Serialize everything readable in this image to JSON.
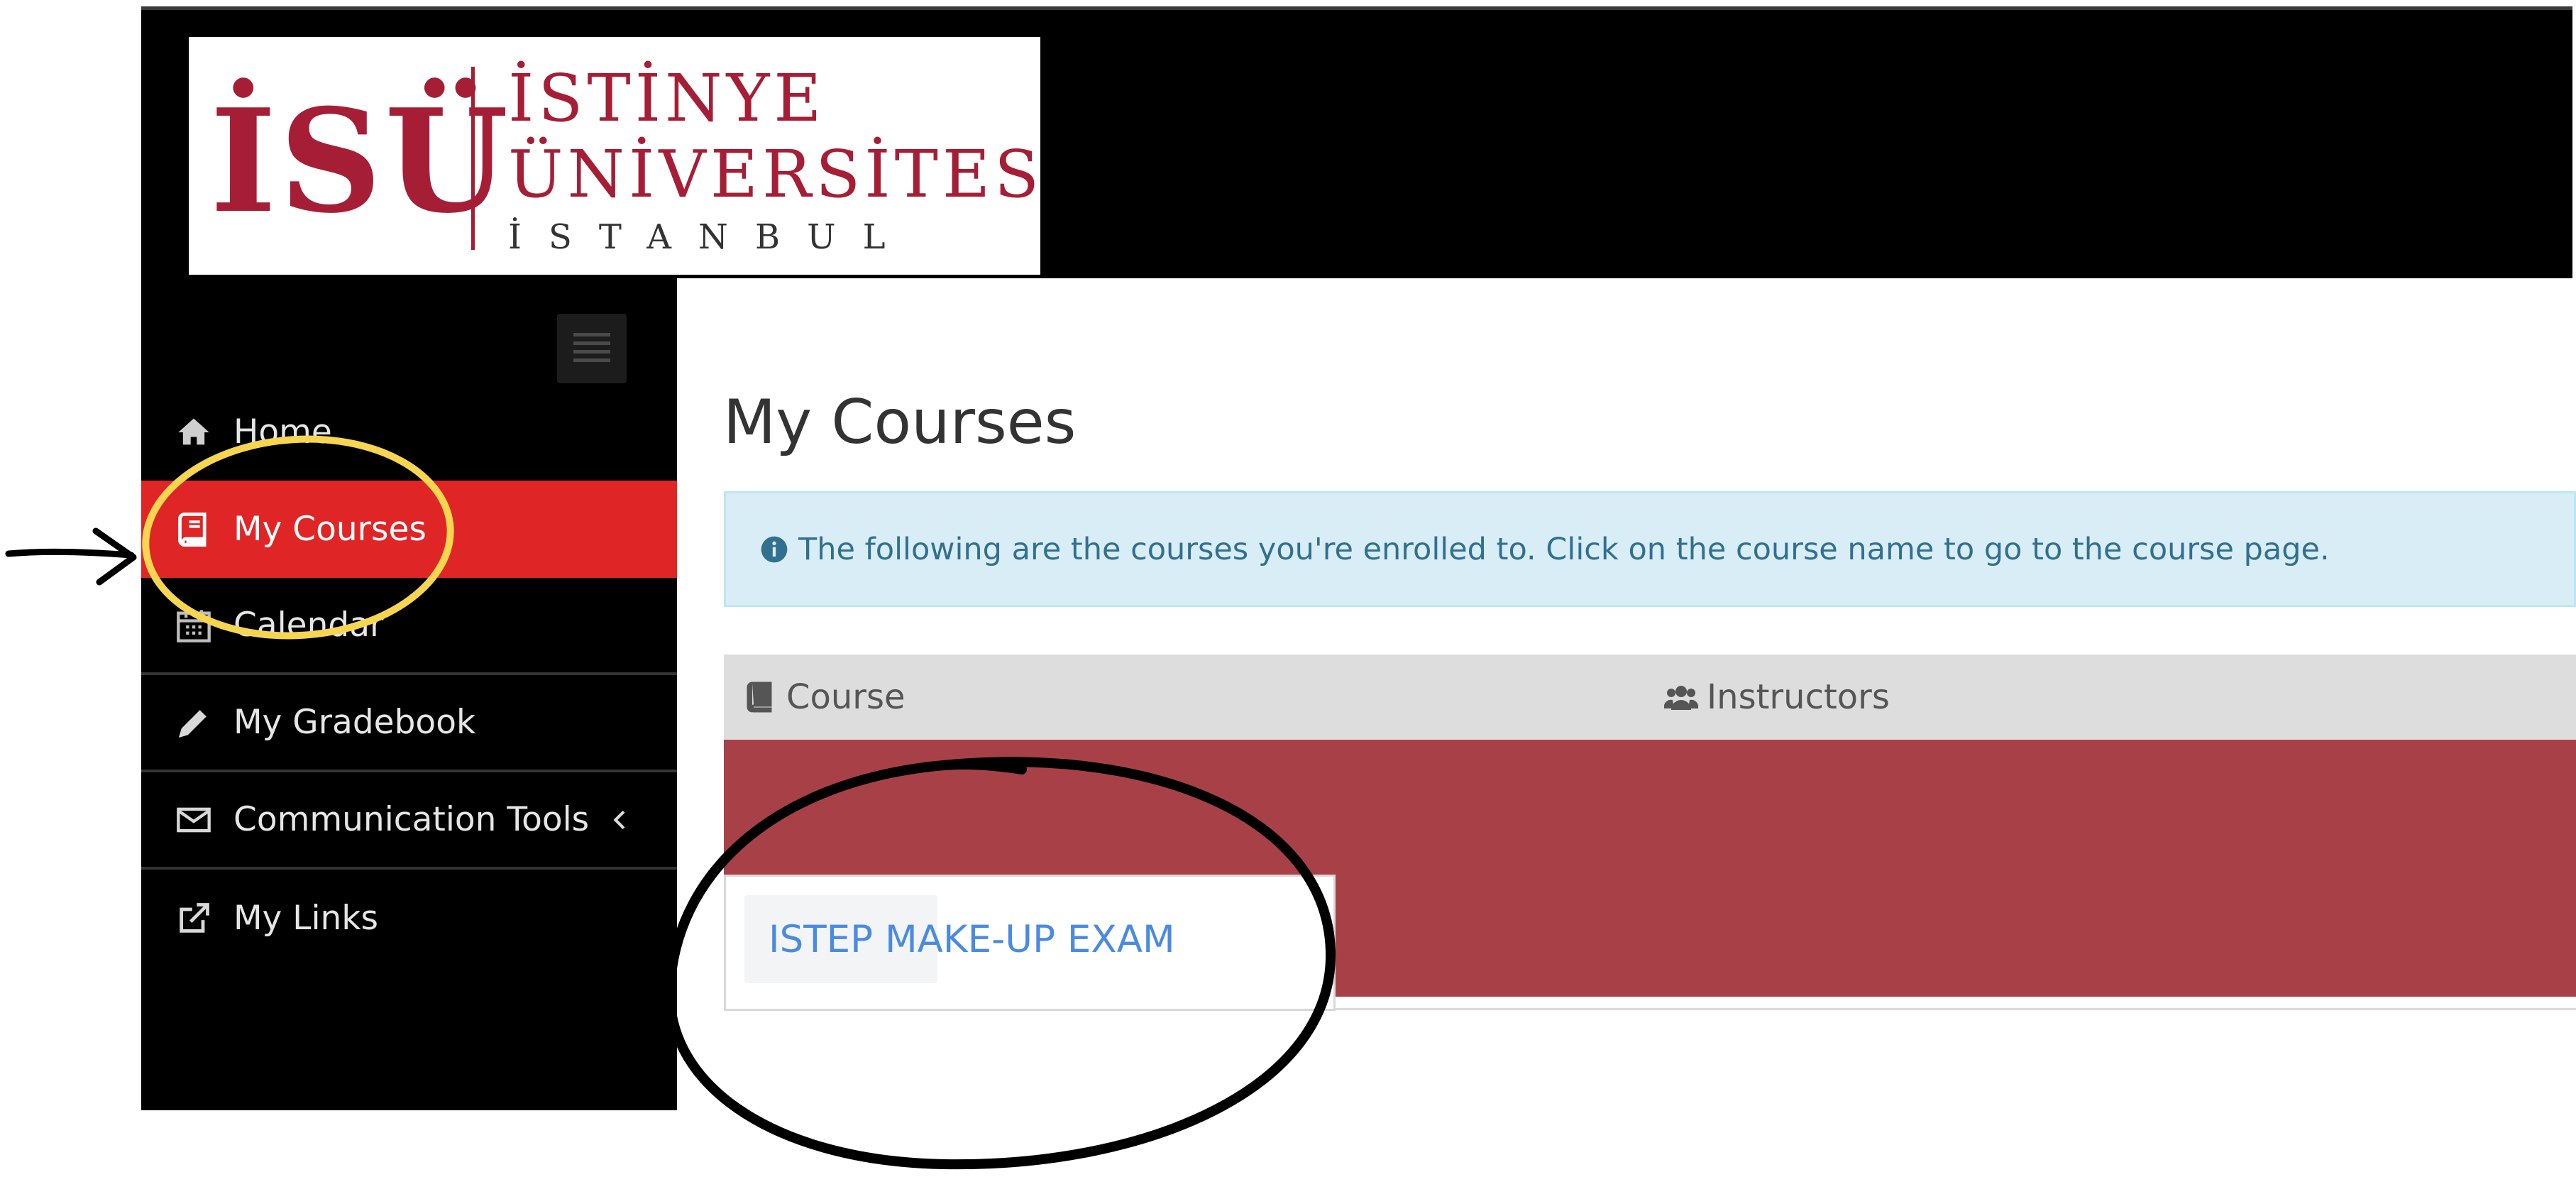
{
  "branding": {
    "logo_mark": "İSÜ",
    "logo_line1": "İSTİNYE",
    "logo_line2": "ÜNİVERSİTESİ",
    "logo_line3": "İ S T A N B U L",
    "brand_color": "#a61e36"
  },
  "sidebar": {
    "toggle_icon": "hamburger-menu-icon",
    "items": [
      {
        "label": "Home",
        "icon": "home-icon"
      },
      {
        "label": "My Courses",
        "icon": "book-icon",
        "active": true
      },
      {
        "label": "Calendar",
        "icon": "calendar-icon"
      },
      {
        "label": "My Gradebook",
        "icon": "pencil-icon"
      },
      {
        "label": "Communication Tools",
        "icon": "envelope-icon",
        "caret": "chevron-left-icon"
      },
      {
        "label": "My Links",
        "icon": "external-link-icon"
      }
    ]
  },
  "main": {
    "title": "My Courses",
    "info": "The following are the courses you're enrolled to. Click on the course name to go to the course page.",
    "table": {
      "headers": [
        {
          "label": "Course",
          "icon": "book-icon"
        },
        {
          "label": "Instructors",
          "icon": "users-icon"
        }
      ],
      "rows": [
        {
          "course": "ISTEP MAKE-UP EXAM",
          "instructors": ""
        }
      ]
    }
  },
  "colors": {
    "sidebar_bg": "#000000",
    "active_item": "#e02526",
    "info_bg": "#d9edf7",
    "info_text": "#31708f",
    "table_head_bg": "#dddddd",
    "course_band": "#a84147",
    "course_link": "#4a8be0",
    "yellow_annotation": "#f6d650",
    "black_annotation": "#000000"
  }
}
